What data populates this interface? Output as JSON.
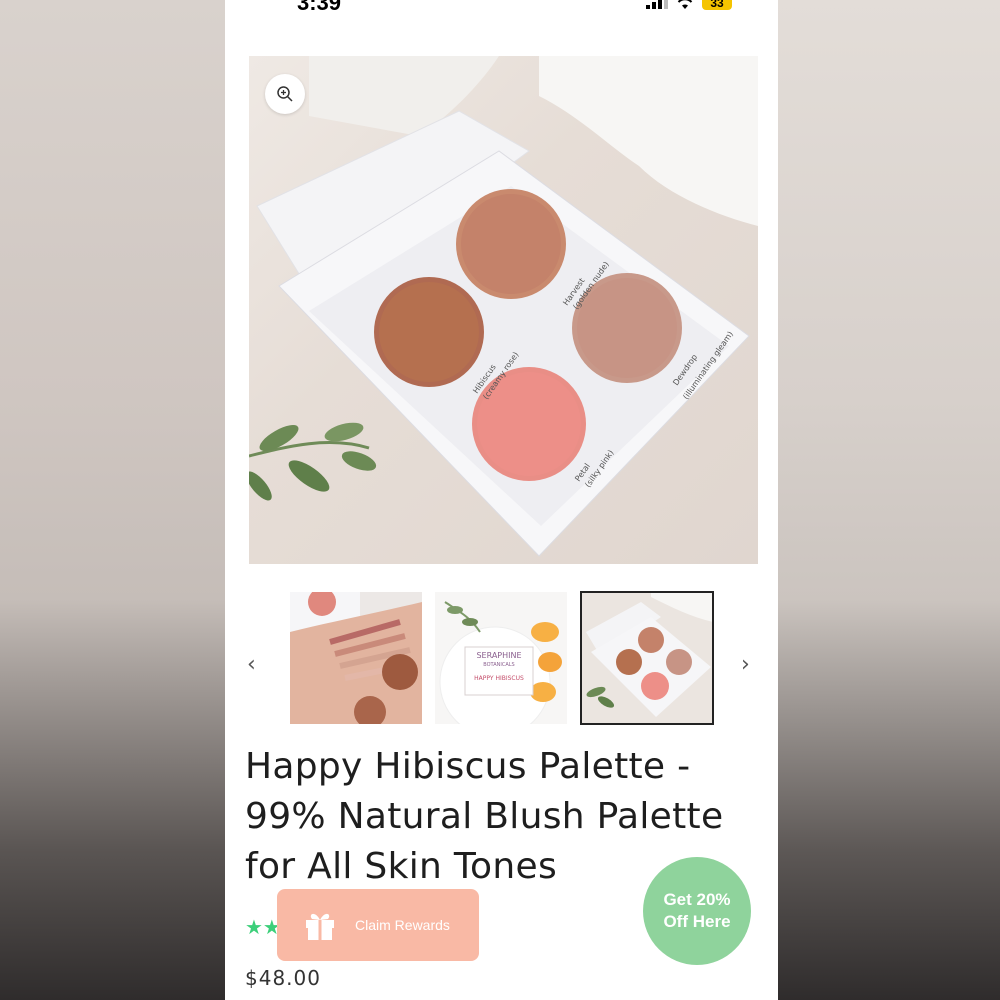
{
  "status_bar": {
    "time": "3:39",
    "battery": "33",
    "signal_icon": "cellular-signal-icon",
    "wifi_icon": "wifi-icon"
  },
  "main_image": {
    "zoom_icon": "zoom-in-icon",
    "palette_labels": {
      "harvest": "Harvest",
      "harvest_desc": "(golden nude)",
      "hibiscus": "Hibiscus",
      "hibiscus_desc": "(creamy rose)",
      "dewdrop": "Dewdrop",
      "dewdrop_desc": "(illuminating gleam)",
      "petal": "Petal",
      "petal_desc": "(silky pink)"
    }
  },
  "carousel": {
    "prev_label": "‹",
    "next_label": "›",
    "thumb2_brand": "SERAPHINE",
    "thumb2_sub": "BOTANICALS",
    "thumb2_product": "HAPPY HIBISCUS"
  },
  "product": {
    "title": "Happy Hibiscus Palette - 99% Natural Blush Palette for All Skin Tones",
    "price": "$48.00",
    "stars": "★★"
  },
  "claim_rewards": {
    "label": "Claim Rewards",
    "icon": "gift-icon"
  },
  "discount_badge": {
    "line1": "Get 20%",
    "line2": "Off Here"
  },
  "colors": {
    "claim_bg": "#f9b9a5",
    "badge_bg": "#8fd39c",
    "stars": "#3ccf7a"
  }
}
